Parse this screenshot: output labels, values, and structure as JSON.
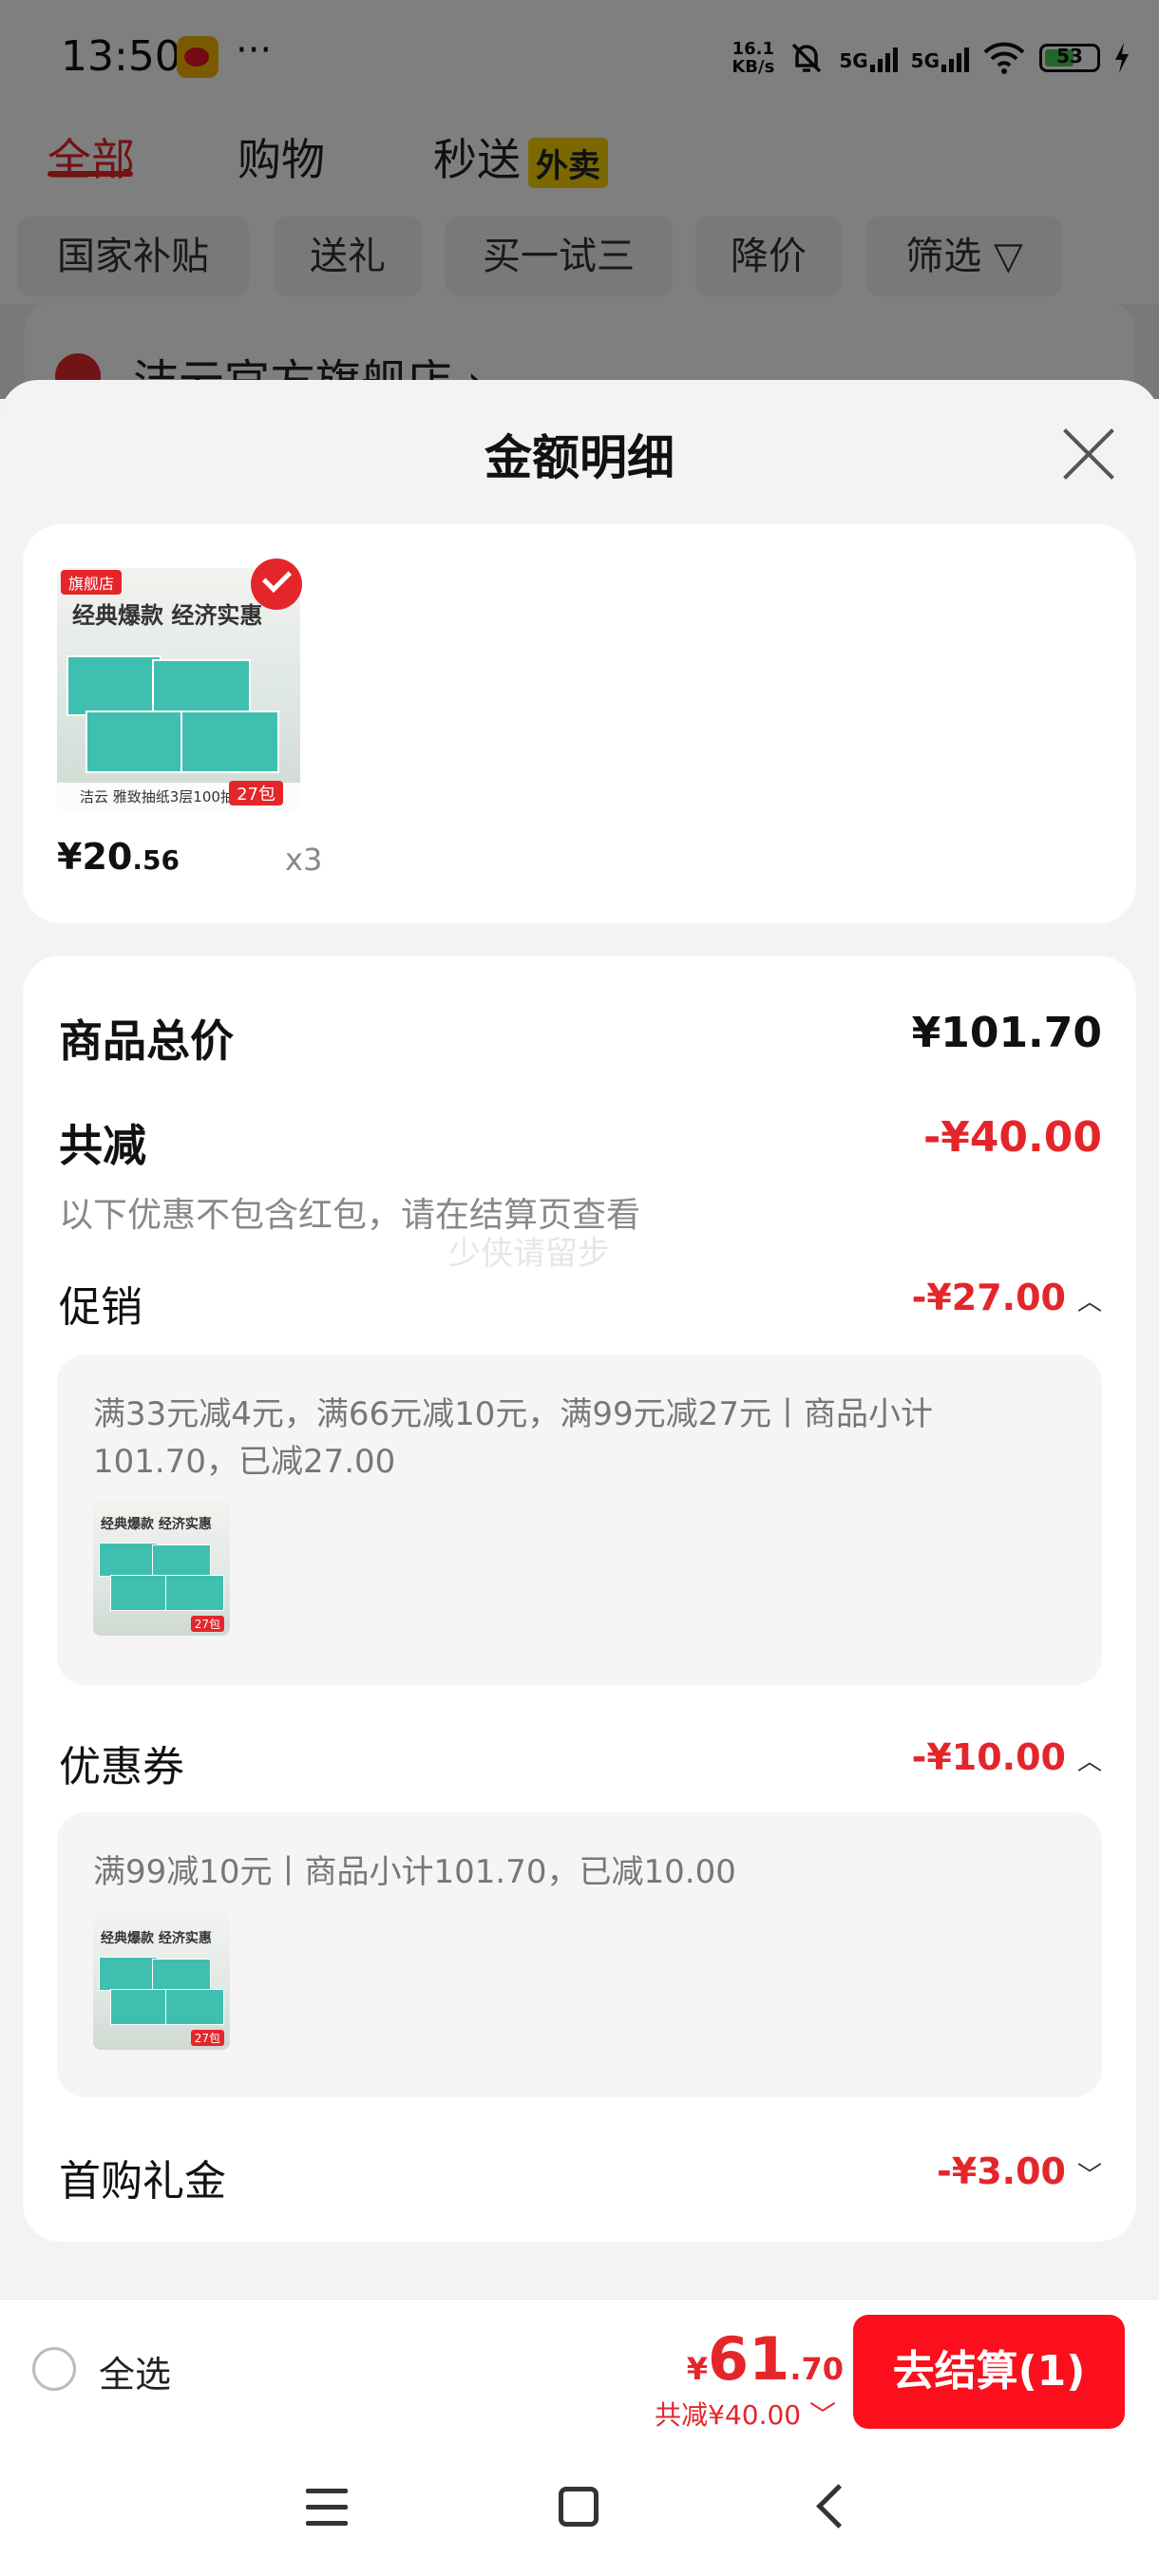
{
  "status_bar": {
    "time": "13:50",
    "app_icon": "weibo-icon",
    "more": "···",
    "net_speed_value": "16.1",
    "net_speed_unit": "KB/s",
    "mute_icon": "bell-off-icon",
    "sim1": "5G",
    "sim2": "5G",
    "wifi_icon": "wifi-icon",
    "battery": "53",
    "charging_icon": "bolt-icon"
  },
  "background_page": {
    "tabs": [
      "全部",
      "购物",
      "秒送"
    ],
    "waimai_badge": "外卖",
    "filter_chips": [
      "国家补贴",
      "送礼",
      "买一试三",
      "降价",
      "筛选"
    ],
    "store_name": "洁云官方旗舰店 ›"
  },
  "sheet": {
    "title": "金额明细",
    "product": {
      "image_badge": "旗舰店",
      "image_headline": "经典爆款  经济实惠",
      "image_caption": "洁云 雅致抽纸3层100抽",
      "image_count": "27包",
      "price_symbol": "¥",
      "price_int": "20",
      "price_dec": ".56",
      "quantity": "x3"
    },
    "summary": {
      "total_label": "商品总价",
      "total_value": "¥101.70",
      "reduce_label": "共减",
      "reduce_value": "-¥40.00",
      "note": "以下优惠不包含红包，请在结算页查看",
      "watermark": "少侠请留步"
    },
    "promo": {
      "label": "促销",
      "value": "-¥27.00",
      "caret": "︿",
      "detail": "满33元减4元，满66元减10元，满99元减27元丨商品小计101.70，已减27.00"
    },
    "coupon": {
      "label": "优惠券",
      "value": "-¥10.00",
      "caret": "︿",
      "detail": "满99减10元丨商品小计101.70，已减10.00"
    },
    "first_gift": {
      "label": "首购礼金",
      "value": "-¥3.00",
      "caret": "﹀"
    }
  },
  "bottom_bar": {
    "select_all": "全选",
    "total_symbol": "¥",
    "total_int": "61",
    "total_dec": ".70",
    "total_reduce": "共减¥40.00 ﹀",
    "checkout": "去结算(1)"
  },
  "colors": {
    "accent_red": "#e4262b",
    "checkout_red": "#fb0f1d",
    "card_bg": "#ffffff",
    "sheet_bg": "#f3f3f3"
  }
}
